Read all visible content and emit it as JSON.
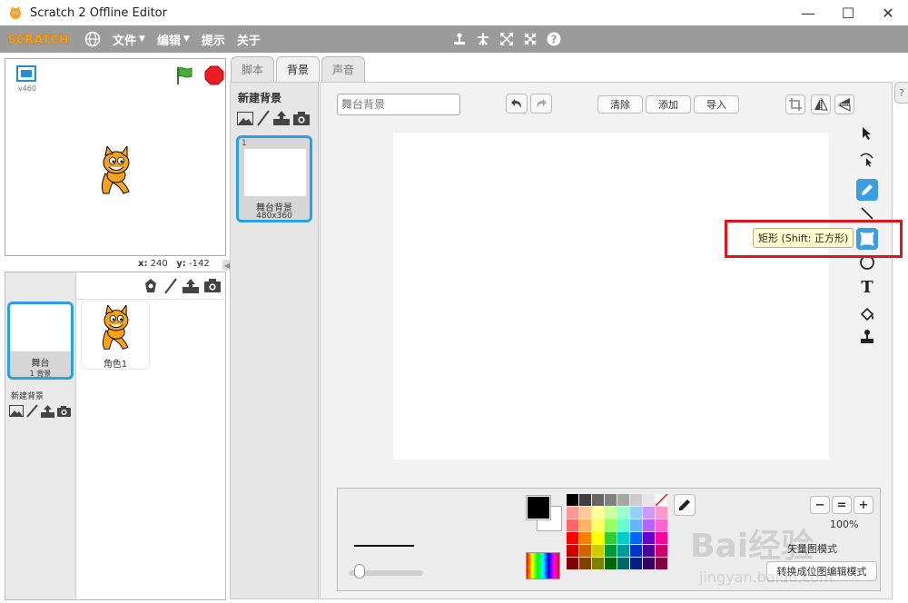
{
  "window": {
    "title": "Scratch 2 Offline Editor",
    "minimize": "—",
    "maximize": "☐",
    "close": "✕"
  },
  "menu": {
    "logo_text": "SCRATCH",
    "file": "文件",
    "edit": "编辑",
    "tips": "提示",
    "about": "关于",
    "caret": "▼"
  },
  "stage": {
    "version": "v460",
    "x_label": "x:",
    "x_value": "240",
    "y_label": "y:",
    "y_value": "-142"
  },
  "sprites": {
    "stage_label": "舞台",
    "stage_backdrop_count": "1 背景",
    "new_backdrop": "新建背景",
    "sprite1_label": "角色1"
  },
  "tabs": [
    {
      "label": "脚本"
    },
    {
      "label": "背景"
    },
    {
      "label": "声音"
    }
  ],
  "backdrops": {
    "title": "新建背景",
    "items": [
      {
        "number": "1",
        "name": "舞台背景",
        "size": "480x360"
      }
    ]
  },
  "paint": {
    "name_placeholder": "舞台背景",
    "clear": "清除",
    "add": "添加",
    "import": "导入",
    "tooltip": "矩形 (Shift: 正方形)",
    "zoom_level": "100%",
    "bitmap_mode": "矢量图模式",
    "convert_vector": "转换成位图编辑模式",
    "zoom_out": "−",
    "zoom_reset": "=",
    "zoom_in": "+"
  },
  "help_tab": "?",
  "colors": {
    "accent": "#2aa0e0",
    "menubar": "#9b9b9b",
    "highlight": "#e0141e",
    "swatches": [
      "#000000",
      "#3f3f3f",
      "#666666",
      "#808080",
      "#a6a6a6",
      "#cccccc",
      "#e6e6e6",
      "#ffffff",
      "#ff9999",
      "#ffcc99",
      "#ffff99",
      "#ccff99",
      "#99ffcc",
      "#99ccff",
      "#cc99ff",
      "#ff99cc",
      "#ff6666",
      "#ffb366",
      "#ffff66",
      "#99ff66",
      "#66ffcc",
      "#66b3ff",
      "#b366ff",
      "#ff66cc",
      "#ff0000",
      "#ff8000",
      "#ffff00",
      "#33cc33",
      "#00cccc",
      "#0066ff",
      "#6600cc",
      "#ff0099",
      "#cc0000",
      "#cc6600",
      "#cccc00",
      "#009933",
      "#009999",
      "#0033cc",
      "#4d0099",
      "#cc0066",
      "#800000",
      "#804000",
      "#808000",
      "#006600",
      "#006666",
      "#001f80",
      "#330066",
      "#800040"
    ]
  },
  "watermark": {
    "main": "Bai经验",
    "sub": "jingyan.baidu.com"
  }
}
